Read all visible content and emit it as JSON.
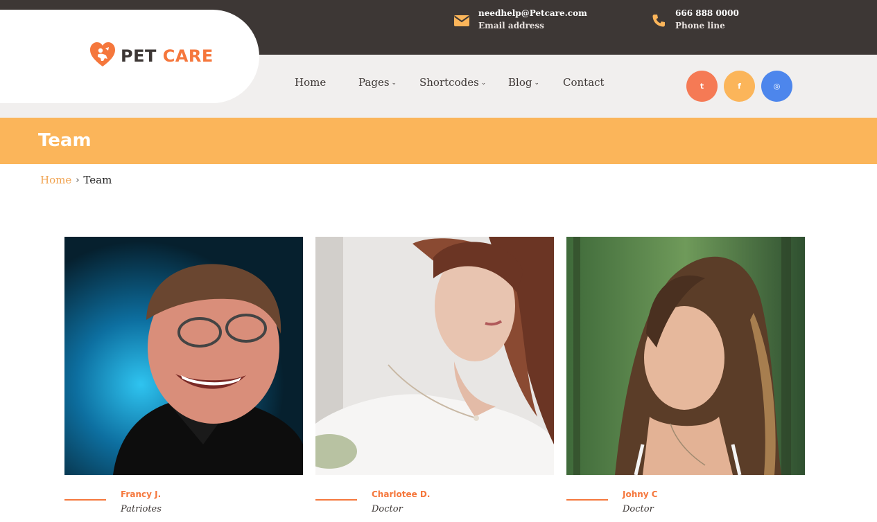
{
  "brand": {
    "logo_pet": "PET",
    "logo_care": "CARE",
    "icon": "heart-pet-icon",
    "accent": "#f5773c"
  },
  "topbar": {
    "email": {
      "value": "needhelp@Petcare.com",
      "label": "Email address",
      "icon": "envelope-icon"
    },
    "phone": {
      "value": "666 888 0000",
      "label": "Phone line",
      "icon": "phone-icon"
    }
  },
  "nav": {
    "items": [
      {
        "label": "Home",
        "has_dropdown": false
      },
      {
        "label": "Pages",
        "has_dropdown": true
      },
      {
        "label": "Shortcodes",
        "has_dropdown": true
      },
      {
        "label": "Blog",
        "has_dropdown": true
      },
      {
        "label": "Contact",
        "has_dropdown": false
      }
    ],
    "dropdown_glyph": "⌄"
  },
  "social": [
    {
      "network": "twitter",
      "glyph": "t",
      "color": "#f57a55"
    },
    {
      "network": "facebook",
      "glyph": "f",
      "color": "#fbb55a"
    },
    {
      "network": "instagram",
      "glyph": "◎",
      "color": "#4d86ec"
    }
  ],
  "page": {
    "title": "Team",
    "title_bg": "#fbb55a"
  },
  "breadcrumb": {
    "home": "Home",
    "separator": "›",
    "current": "Team"
  },
  "team": [
    {
      "name": "Francy J.",
      "role": "Patriotes"
    },
    {
      "name": "Charlotee D.",
      "role": "Doctor"
    },
    {
      "name": "Johny C",
      "role": "Doctor"
    }
  ]
}
